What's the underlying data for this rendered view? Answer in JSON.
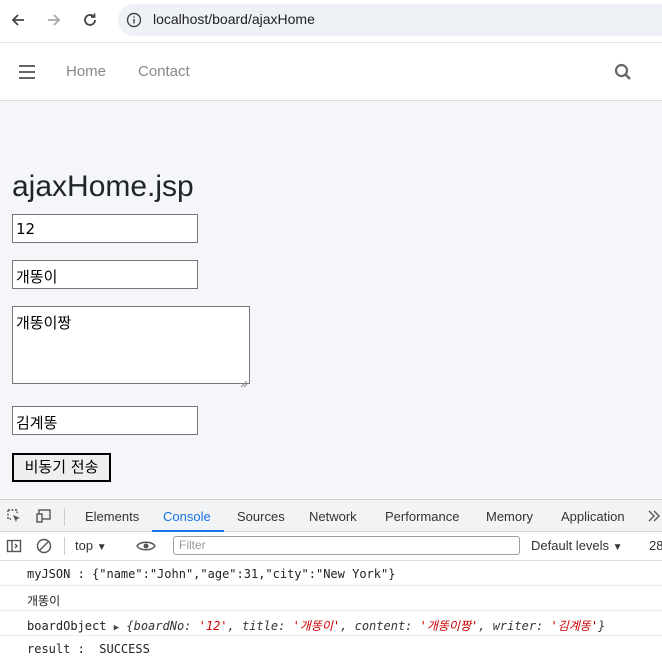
{
  "browser": {
    "url": "localhost/board/ajaxHome"
  },
  "sitenav": {
    "links": [
      "Home",
      "Contact"
    ]
  },
  "page": {
    "title": "ajaxHome.jsp",
    "board_no_value": "12",
    "title_value": "개똥이",
    "content_value": "개똥이짱",
    "writer_value": "김계똥",
    "submit_label": "비동기 전송"
  },
  "devtools": {
    "tabs": [
      "Elements",
      "Console",
      "Sources",
      "Network",
      "Performance",
      "Memory",
      "Application"
    ],
    "active_tab": "Console",
    "context": "top",
    "filter_placeholder": "Filter",
    "levels_label": "Default levels",
    "issues_count": "28",
    "console": {
      "line1": "myJSON : {\"name\":\"John\",\"age\":31,\"city\":\"New York\"}",
      "line2": "개똥이",
      "line3_label": "boardObject",
      "line3_obj": {
        "open": "{boardNo: ",
        "boardNo": "'12'",
        "sep1": ", title: ",
        "title": "'개똥이'",
        "sep2": ", content: ",
        "content": "'개똥이짱'",
        "sep3": ", writer: ",
        "writer": "'김계똥'",
        "close": "}"
      },
      "line4": "result :  SUCCESS"
    }
  }
}
